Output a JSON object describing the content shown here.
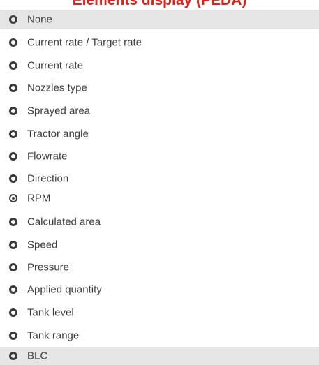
{
  "title": "Elements display (PEDA)",
  "options": [
    {
      "label": "None",
      "selected": false
    },
    {
      "label": "Current rate / Target rate",
      "selected": false
    },
    {
      "label": "Current rate",
      "selected": false
    },
    {
      "label": "Nozzles type",
      "selected": false
    },
    {
      "label": "Sprayed area",
      "selected": false
    },
    {
      "label": "Tractor angle",
      "selected": false
    },
    {
      "label": "Flowrate",
      "selected": false
    },
    {
      "label": "Direction",
      "selected": false
    },
    {
      "label": "RPM",
      "selected": true
    },
    {
      "label": "Calculated area",
      "selected": false
    },
    {
      "label": "Speed",
      "selected": false
    },
    {
      "label": "Pressure",
      "selected": false
    },
    {
      "label": "Applied quantity",
      "selected": false
    },
    {
      "label": "Tank level",
      "selected": false
    },
    {
      "label": "Tank range",
      "selected": false
    },
    {
      "label": "BLC",
      "selected": false
    }
  ],
  "colors": {
    "title": "#e0201a",
    "highlight_row": "#e6e6e6",
    "text": "#3c3c3c"
  }
}
